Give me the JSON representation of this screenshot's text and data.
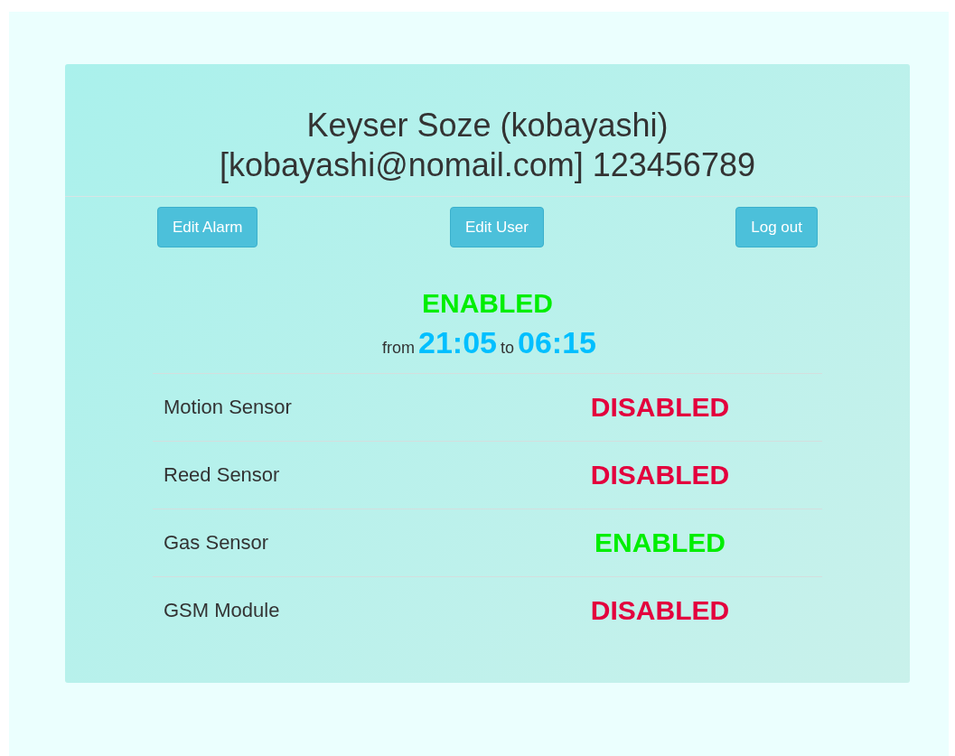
{
  "header": {
    "name_line": "Keyser Soze (kobayashi)",
    "contact_line": "[kobayashi@nomail.com] 123456789"
  },
  "buttons": [
    "Edit Alarm",
    "Edit User",
    "Log out"
  ],
  "alarm": {
    "status": "ENABLED",
    "enabled": true,
    "from_label": "from",
    "from": "21:05",
    "to_label": "to",
    "to": "06:15"
  },
  "sensors": [
    {
      "name": "Motion Sensor",
      "status": "DISABLED",
      "enabled": false
    },
    {
      "name": "Reed Sensor",
      "status": "DISABLED",
      "enabled": false
    },
    {
      "name": "Gas Sensor",
      "status": "ENABLED",
      "enabled": true
    },
    {
      "name": "GSM Module",
      "status": "DISABLED",
      "enabled": false
    }
  ]
}
